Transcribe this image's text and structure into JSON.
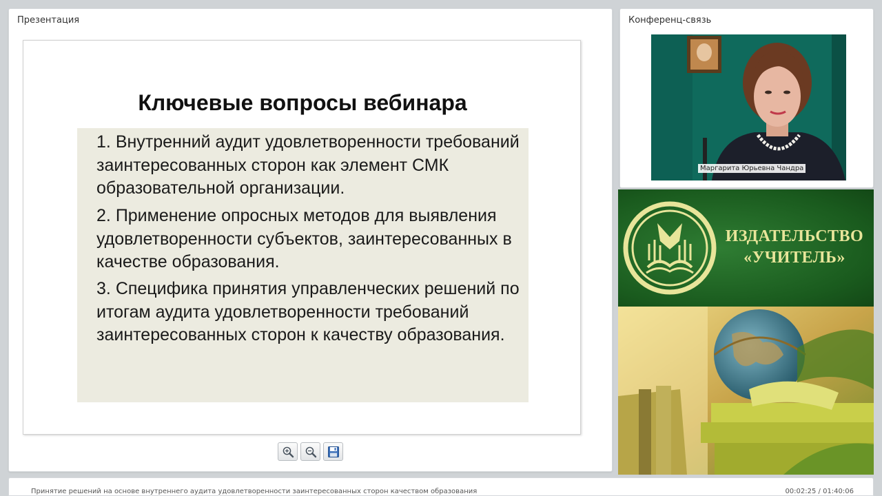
{
  "presentation": {
    "panel_title": "Презентация",
    "slide": {
      "title": "Ключевые вопросы вебинара",
      "items": [
        {
          "number": "1.",
          "text": "Внутренний аудит удовлетворенности требований заинтересованных сторон как элемент СМК образовательной организации."
        },
        {
          "number": "2.",
          "text": "Применение опросных методов для выявления удовлетворенности субъектов, заинтересованных в качестве образования."
        },
        {
          "number": "3.",
          "text": "Специфика принятия управленческих решений по итогам аудита удовлетворенности требований заинтересованных сторон к качеству образования."
        }
      ]
    },
    "toolbar": {
      "zoom_in_icon": "zoom-in-icon",
      "zoom_out_icon": "zoom-out-icon",
      "save_icon": "save-icon"
    }
  },
  "conference": {
    "panel_title": "Конференц-связь",
    "participant_name": "Маргарита Юрьевна Чандра"
  },
  "ad": {
    "line1": "ИЗДАТЕЛЬСТВО",
    "line2": "«УЧИТЕЛЬ»",
    "colors": {
      "green": "#1a5b1e",
      "gold": "#e8e59a"
    }
  },
  "status": {
    "webinar_title": "Принятие решений на основе внутреннего аудита удовлетворенности заинтересованных сторон качеством образования",
    "time": "00:02:25 / 01:40:06"
  }
}
